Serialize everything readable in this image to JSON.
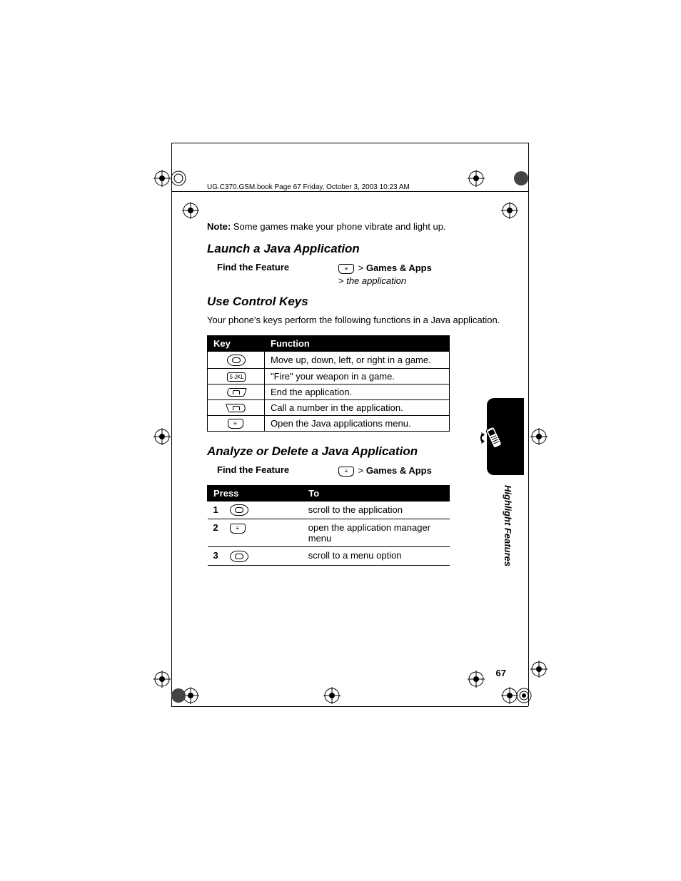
{
  "header_path": "UG.C370.GSM.book  Page 67  Friday, October 3, 2003  10:23 AM",
  "note_label": "Note:",
  "note_text": " Some games make your phone vibrate and light up.",
  "section1_title": "Launch a Java Application",
  "find_feature_label": "Find the Feature",
  "path1_menu": "Games & Apps",
  "path1_sub": "the application",
  "section2_title": "Use Control Keys",
  "section2_body": "Your phone's keys perform the following functions in a Java application.",
  "key_table": {
    "head": {
      "key": "Key",
      "func": "Function"
    },
    "rows": [
      {
        "key_name": "nav-key",
        "func": "Move up, down, left, or right in a game."
      },
      {
        "key_name": "key-5",
        "func": "\"Fire\" your weapon in a game."
      },
      {
        "key_name": "end-key",
        "func": "End the application."
      },
      {
        "key_name": "send-key",
        "func": "Call a number in the application."
      },
      {
        "key_name": "menu-key",
        "func": "Open the Java applications menu."
      }
    ]
  },
  "section3_title": "Analyze or Delete a Java Application",
  "path3_menu": "Games & Apps",
  "press_table": {
    "head": {
      "press": "Press",
      "to": "To"
    },
    "rows": [
      {
        "num": "1",
        "key_name": "nav-key",
        "desc": "scroll to the application"
      },
      {
        "num": "2",
        "key_name": "menu-key",
        "desc": "open the application manager menu"
      },
      {
        "num": "3",
        "key_name": "nav-key",
        "desc": "scroll to a menu option"
      }
    ]
  },
  "side_label": "Highlight Features",
  "page_number": "67",
  "gt": ">"
}
